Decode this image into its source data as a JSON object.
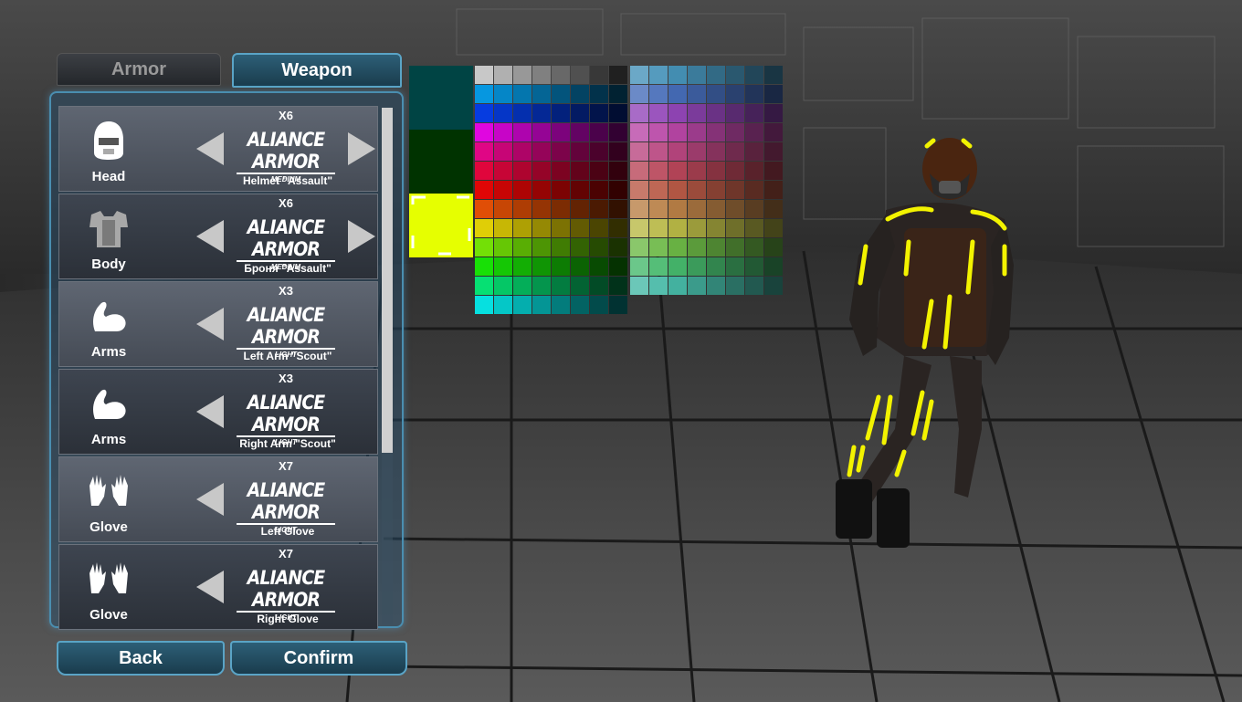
{
  "tabs": {
    "armor": "Armor",
    "weapon": "Weapon",
    "active": "weapon"
  },
  "slots": [
    {
      "name": "Head",
      "icon": "helmet-icon",
      "count": "X6",
      "brand": "ALIANCE ARMOR",
      "grade": "MEDIUM",
      "item": "Helmet \"Assault\"",
      "has_right_arrow": true
    },
    {
      "name": "Body",
      "icon": "body-armor-icon",
      "count": "X6",
      "brand": "ALIANCE ARMOR",
      "grade": "MEDIUM",
      "item": "Броня \"Assault\"",
      "has_right_arrow": true
    },
    {
      "name": "Arms",
      "icon": "arm-icon",
      "count": "X3",
      "brand": "ALIANCE ARMOR",
      "grade": "LIGHT",
      "item": "Left Arm \"Scout\"",
      "has_right_arrow": false
    },
    {
      "name": "Arms",
      "icon": "arm-icon",
      "count": "X3",
      "brand": "ALIANCE ARMOR",
      "grade": "LIGHT",
      "item": "Right Arm \"Scout\"",
      "has_right_arrow": false
    },
    {
      "name": "Glove",
      "icon": "gloves-icon",
      "count": "X7",
      "brand": "ALIANCE ARMOR",
      "grade": "LIGHT",
      "item": "Left Glove",
      "has_right_arrow": false
    },
    {
      "name": "Glove",
      "icon": "gloves-icon",
      "count": "X7",
      "brand": "ALIANCE ARMOR",
      "grade": "LIGHT",
      "item": "Right Glove",
      "has_right_arrow": false
    }
  ],
  "buttons": {
    "back": "Back",
    "confirm": "Confirm"
  },
  "palette": {
    "swatches": [
      "#004444",
      "#003300",
      "#e6ff00"
    ],
    "selected_swatch": 2,
    "selected_color": "#e6ff00"
  },
  "colors": {
    "accent": "#5aa4c6",
    "glow": "#f3f300"
  }
}
